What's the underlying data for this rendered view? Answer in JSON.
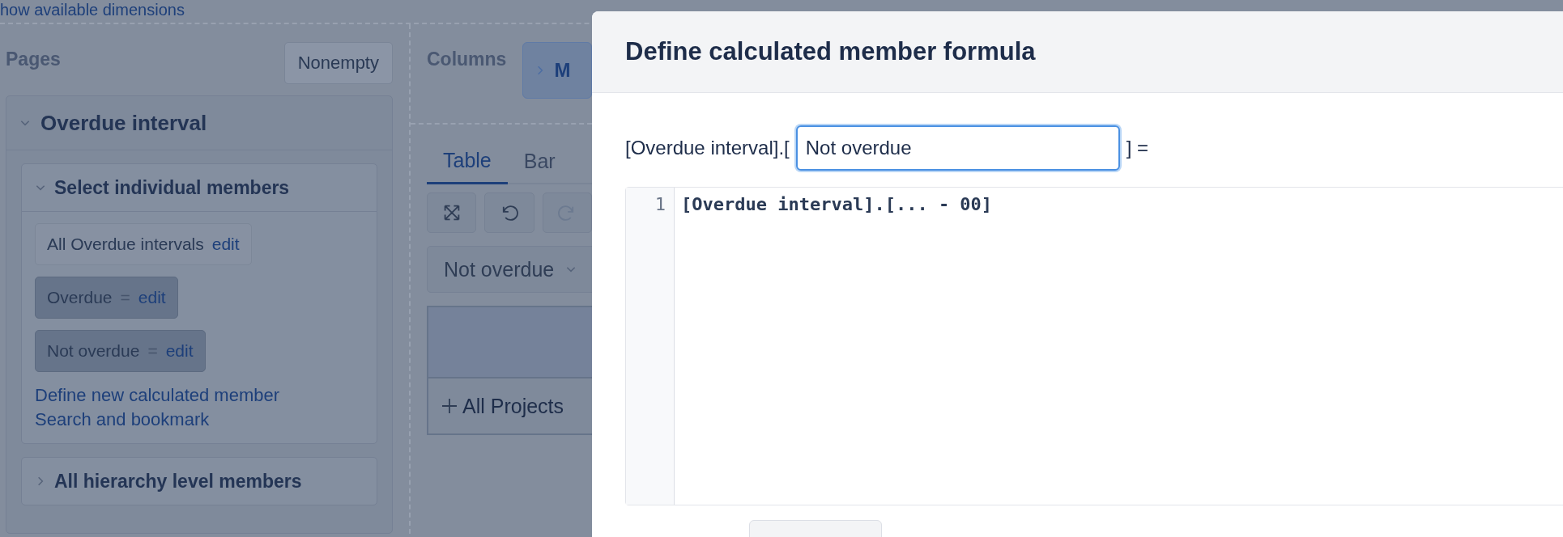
{
  "top_link": "how available dimensions",
  "pages": {
    "title": "Pages",
    "nonempty_button": "Nonempty",
    "dimension": {
      "title": "Overdue interval",
      "expanded": true,
      "sections": [
        {
          "title": "Select individual members",
          "expanded": true,
          "members": [
            {
              "kind": "all",
              "label": "All Overdue intervals",
              "action": "edit"
            },
            {
              "kind": "calculated",
              "label": "Overdue",
              "operator": "=",
              "action": "edit"
            },
            {
              "kind": "calculated",
              "label": "Not overdue",
              "operator": "=",
              "action": "edit"
            }
          ],
          "links": [
            "Define new calculated member",
            "Search and bookmark"
          ]
        },
        {
          "title": "All hierarchy level members",
          "expanded": false
        }
      ]
    }
  },
  "columns": {
    "title": "Columns",
    "chip": "M"
  },
  "view_tabs": [
    {
      "label": "Table",
      "selected": true
    },
    {
      "label": "Bar",
      "selected": false
    }
  ],
  "toolbar": [
    {
      "kind": "fullscreen",
      "disabled": false
    },
    {
      "kind": "undo",
      "disabled": false
    },
    {
      "kind": "redo",
      "disabled": true
    }
  ],
  "page_filter": {
    "value": "Not overdue"
  },
  "table": {
    "rows": [
      {
        "label": "All Projects"
      }
    ]
  },
  "modal": {
    "title": "Define calculated member formula",
    "prefix": "[Overdue interval].[",
    "name_value": "Not overdue",
    "suffix": "] =",
    "editor": {
      "lines": [
        {
          "number": "1",
          "code": "[Overdue interval].[... - 00]"
        }
      ]
    }
  }
}
